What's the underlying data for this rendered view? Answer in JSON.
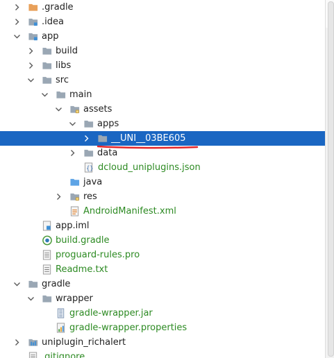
{
  "colors": {
    "selection": "#1a66c2",
    "generated_text": "#2c8a22",
    "folder_grey": "#9aa7b4",
    "folder_orange": "#e8a05a",
    "annotation_red": "#e3262a"
  },
  "tree": {
    "rows": [
      {
        "label": ".gradle",
        "icon": "folder-orange-icon",
        "chevron": "right"
      },
      {
        "label": ".idea",
        "icon": "folder-module-icon",
        "chevron": "right"
      },
      {
        "label": "app",
        "icon": "folder-module-icon",
        "chevron": "down"
      },
      {
        "label": "build",
        "icon": "folder-icon",
        "chevron": "right"
      },
      {
        "label": "libs",
        "icon": "folder-icon",
        "chevron": "right"
      },
      {
        "label": "src",
        "icon": "folder-icon",
        "chevron": "down"
      },
      {
        "label": "main",
        "icon": "folder-icon",
        "chevron": "down"
      },
      {
        "label": "assets",
        "icon": "folder-resource-icon",
        "chevron": "down"
      },
      {
        "label": "apps",
        "icon": "folder-icon",
        "chevron": "down"
      },
      {
        "label": "__UNI__03BE605",
        "icon": "folder-icon",
        "chevron": "right",
        "selected": true
      },
      {
        "label": "data",
        "icon": "folder-icon",
        "chevron": "right"
      },
      {
        "label": "dcloud_uniplugins.json",
        "icon": "json-file-icon",
        "chevron": "",
        "green": true
      },
      {
        "label": "java",
        "icon": "folder-source-icon",
        "chevron": ""
      },
      {
        "label": "res",
        "icon": "folder-resource-icon",
        "chevron": "right"
      },
      {
        "label": "AndroidManifest.xml",
        "icon": "xml-file-icon",
        "chevron": "",
        "green": true
      },
      {
        "label": "app.iml",
        "icon": "iml-file-icon",
        "chevron": ""
      },
      {
        "label": "build.gradle",
        "icon": "gradle-file-icon",
        "chevron": "",
        "green": true
      },
      {
        "label": "proguard-rules.pro",
        "icon": "text-file-icon",
        "chevron": "",
        "green": true
      },
      {
        "label": "Readme.txt",
        "icon": "text-file-icon",
        "chevron": "",
        "green": true
      },
      {
        "label": "gradle",
        "icon": "folder-icon",
        "chevron": "down"
      },
      {
        "label": "wrapper",
        "icon": "folder-icon",
        "chevron": "down"
      },
      {
        "label": "gradle-wrapper.jar",
        "icon": "jar-file-icon",
        "chevron": "",
        "green": true
      },
      {
        "label": "gradle-wrapper.properties",
        "icon": "properties-file-icon",
        "chevron": "",
        "green": true
      },
      {
        "label": "uniplugin_richalert",
        "icon": "module-icon",
        "chevron": "right"
      },
      {
        "label": ".gitignore",
        "icon": "text-file-icon",
        "chevron": "",
        "green": true
      }
    ]
  }
}
